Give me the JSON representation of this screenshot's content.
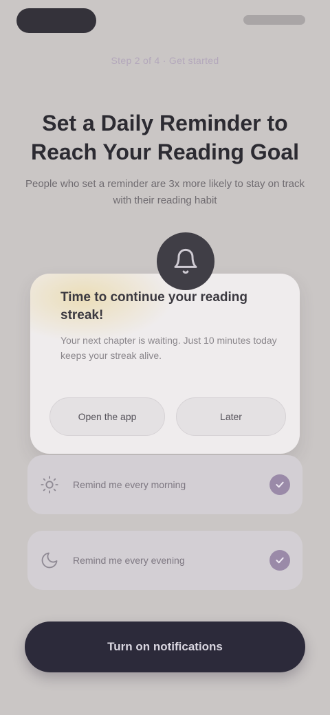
{
  "eyebrow": "Step 2 of 4 · Get started",
  "headline": "Set a Daily Reminder to Reach Your Reading Goal",
  "subtitle": "People who set a reminder are 3x more likely to stay on track with their reading habit",
  "card": {
    "title": "Time to continue your reading streak!",
    "body": "Your next chapter is waiting. Just 10 minutes today keeps your streak alive.",
    "primary_label": "Open the app",
    "secondary_label": "Later"
  },
  "options": [
    {
      "label": "Remind me every morning",
      "checked": true
    },
    {
      "label": "Remind me every evening",
      "checked": true
    }
  ],
  "cta_label": "Turn on notifications",
  "colors": {
    "background": "#cac6c5",
    "accent": "#9a8aa8",
    "cta": "#2c2a3a"
  }
}
